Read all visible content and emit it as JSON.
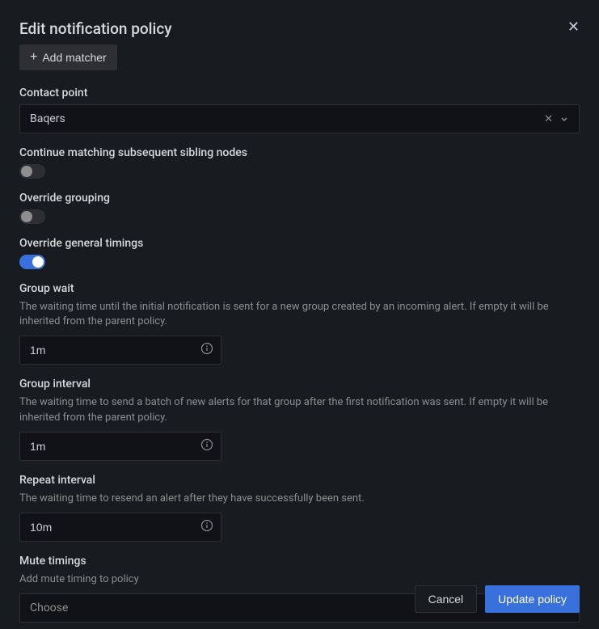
{
  "header": {
    "title": "Edit notification policy"
  },
  "addMatcher": {
    "label": "Add matcher"
  },
  "contactPoint": {
    "label": "Contact point",
    "value": "Baqers"
  },
  "continueMatching": {
    "label": "Continue matching subsequent sibling nodes",
    "enabled": false
  },
  "overrideGrouping": {
    "label": "Override grouping",
    "enabled": false
  },
  "overrideTimings": {
    "label": "Override general timings",
    "enabled": true
  },
  "groupWait": {
    "label": "Group wait",
    "description": "The waiting time until the initial notification is sent for a new group created by an incoming alert. If empty it will be inherited from the parent policy.",
    "value": "1m"
  },
  "groupInterval": {
    "label": "Group interval",
    "description": "The waiting time to send a batch of new alerts for that group after the first notification was sent. If empty it will be inherited from the parent policy.",
    "value": "1m"
  },
  "repeatInterval": {
    "label": "Repeat interval",
    "description": "The waiting time to resend an alert after they have successfully been sent.",
    "value": "10m"
  },
  "muteTimings": {
    "label": "Mute timings",
    "description": "Add mute timing to policy",
    "placeholder": "Choose"
  },
  "footer": {
    "cancel": "Cancel",
    "update": "Update policy"
  }
}
